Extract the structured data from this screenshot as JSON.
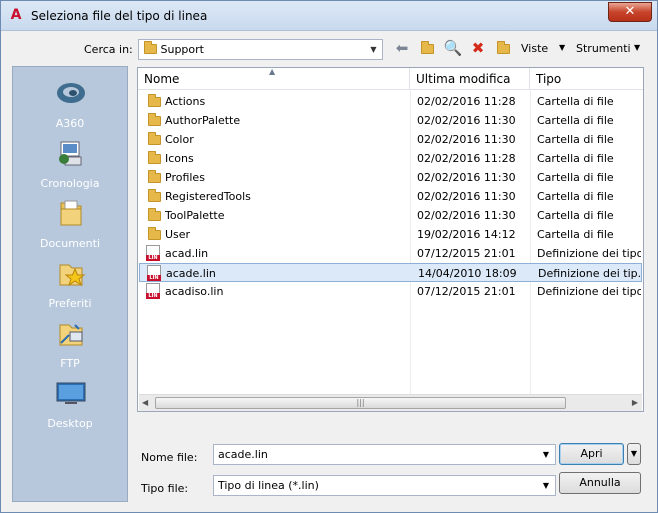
{
  "window": {
    "title": "Seleziona file del tipo di linea",
    "close_glyph": "✕",
    "app_icon": "autocad-icon"
  },
  "lookin": {
    "label": "Cerca in:",
    "value": "Support"
  },
  "toolbar": {
    "views_label": "Viste",
    "tools_label": "Strumenti"
  },
  "places": [
    {
      "label": "A360",
      "icon": "a360-icon"
    },
    {
      "label": "Cronologia",
      "icon": "history-icon"
    },
    {
      "label": "Documenti",
      "icon": "documents-icon"
    },
    {
      "label": "Preferiti",
      "icon": "favorites-icon"
    },
    {
      "label": "FTP",
      "icon": "ftp-icon"
    },
    {
      "label": "Desktop",
      "icon": "desktop-icon"
    }
  ],
  "columns": {
    "name": "Nome",
    "modified": "Ultima modifica",
    "type": "Tipo"
  },
  "files": [
    {
      "name": "Actions",
      "modified": "02/02/2016 11:28",
      "type": "Cartella di file",
      "kind": "folder"
    },
    {
      "name": "AuthorPalette",
      "modified": "02/02/2016 11:30",
      "type": "Cartella di file",
      "kind": "folder"
    },
    {
      "name": "Color",
      "modified": "02/02/2016 11:30",
      "type": "Cartella di file",
      "kind": "folder"
    },
    {
      "name": "Icons",
      "modified": "02/02/2016 11:28",
      "type": "Cartella di file",
      "kind": "folder"
    },
    {
      "name": "Profiles",
      "modified": "02/02/2016 11:30",
      "type": "Cartella di file",
      "kind": "folder"
    },
    {
      "name": "RegisteredTools",
      "modified": "02/02/2016 11:30",
      "type": "Cartella di file",
      "kind": "folder"
    },
    {
      "name": "ToolPalette",
      "modified": "02/02/2016 11:30",
      "type": "Cartella di file",
      "kind": "folder"
    },
    {
      "name": "User",
      "modified": "19/02/2016 14:12",
      "type": "Cartella di file",
      "kind": "folder"
    },
    {
      "name": "acad.lin",
      "modified": "07/12/2015 21:01",
      "type": "Definizione dei tipo...",
      "kind": "lin"
    },
    {
      "name": "acade.lin",
      "modified": "14/04/2010 18:09",
      "type": "Definizione dei tip...",
      "kind": "lin",
      "selected": true
    },
    {
      "name": "acadiso.lin",
      "modified": "07/12/2015 21:01",
      "type": "Definizione dei tipo...",
      "kind": "lin"
    }
  ],
  "filename": {
    "label": "Nome file:",
    "value": "acade.lin"
  },
  "filetype": {
    "label": "Tipo file:",
    "value": "Tipo di linea (*.lin)"
  },
  "buttons": {
    "open": "Apri",
    "cancel": "Annulla"
  }
}
